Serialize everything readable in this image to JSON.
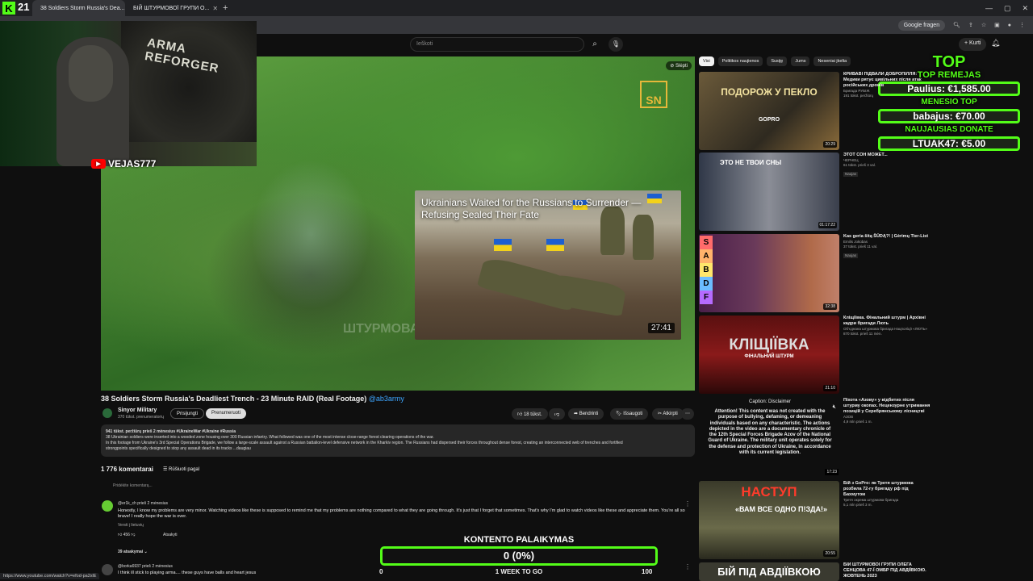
{
  "browser": {
    "tabs": [
      {
        "label": "38 Soldiers Storm Russia's Dea..."
      },
      {
        "label": "БІЙ ШТУРМОВОЇ ГРУПИ О..."
      }
    ],
    "google_pill": "Google fragen",
    "status_url": "https://www.youtube.com/watch?v=efod-pa2xlE"
  },
  "stream": {
    "kick_count": "21",
    "youtube_name": "VEJAS777",
    "poster_text": "ARMA REFORGER"
  },
  "search": {
    "placeholder": "Ieškoti"
  },
  "header": {
    "create_label": "Kurti"
  },
  "video": {
    "hide_label": "Slėpti",
    "logo": "SN",
    "watermark": "ШТУРМОВА БРИГАДА",
    "endcard": {
      "title": "Ukrainians Waited for the Russians to Surrender — Refusing Sealed Their Fate",
      "duration": "27:41"
    }
  },
  "donations": {
    "top": "TOP",
    "top_remejas": "TOP REMEJAS",
    "top_remejas_entry": "Paulius: €1,585.00",
    "menesio_top": "MENESIO TOP",
    "menesio_top_entry": "babajus: €70.00",
    "naujausias": "NAUJAUSIAS DONATE",
    "naujausias_entry": "LTUAK47: €5.00"
  },
  "watch": {
    "title": "38 Soldiers Storm Russia's Deadliest Trench - 23 Minute RAID (Real Footage)",
    "title_tag": "@ab3army",
    "channel": "Sinyor Military",
    "subs": "370 tūkst. prenumeratorių",
    "join": "Prisijungti",
    "subscribe": "Prenumeruoti",
    "likes": "18 tūkst.",
    "share": "Bendrinti",
    "save": "Išsaugoti",
    "clip": "Atkirpti",
    "desc_meta": "941 tūkst. peržiūrų  prieš 2 mėnesius  #UkraineWar #Ukraine #Russia",
    "desc_line1": "38 Ukrainian soldiers were inserted into a wooded zone housing over 300 Russian infantry. What followed was one of the most intense close-range forest clearing operations of the war.",
    "desc_line2": "In this footage from Ukraine's 3rd Special Operations Brigade, we follow a large-scale assault against a Russian battalion-level defensive network in the Kharkiv region. The Russians had dispersed their forces throughout dense forest, creating an interconnected web of trenches and fortified",
    "desc_line3": "strongpoints specifically designed to stop any assault dead in its tracks   ...daugiau"
  },
  "comments": {
    "count": "1 776 komentarai",
    "sort": "Rūšiuoti pagal",
    "add_placeholder": "Pridėkite komentarą...",
    "items": [
      {
        "user": "@er1k_ch  prieš 2 mėnesius",
        "text": "Honestly, I know my problems are very minor. Watching videos like these is supposed to remind me that my problems are nothing compared to what they are going through. It's just that I forget that sometimes. That's why I'm glad to watch videos like these and appreciate them. You're all so brave! I really hope the war is over.",
        "translate": "Versti į lietuvių",
        "likes": "456",
        "reply": "Atsakyti",
        "replies": "39 atsakymai"
      },
      {
        "user": "@borka6937  prieš 2 mėnesius",
        "text": "I think ill stick to playing arma.... these guys have balls and heart jesus"
      }
    ]
  },
  "sidebar": {
    "chips": [
      "Visi",
      "Politikos naujienos",
      "Susiję",
      "Jums",
      "Neseniai įkelta"
    ],
    "recs": [
      {
        "title": "КРИВАВІ ПІДВАЛИ ДОБРОПІЛЛЯ: Медики рятує цивільних після атак російських дронів",
        "channel": "Бригада РУБІЖ",
        "meta": "191 tūkst. peržiūrų",
        "thumb_text": "ПОДОРОЖ У ПЕКЛО",
        "thumb_sub": "GOPRO",
        "duration": "20:29"
      },
      {
        "title": "ЭТОТ СОН МОЖЕТ...",
        "channel": "ЧЕРНЕЦ",
        "meta": "61 tūkst.  prieš 3 val.",
        "badge": "Naujas",
        "thumb_text": "ЭТО НЕ ТВОИ СНЫ",
        "duration": "01:17:22"
      },
      {
        "title": "Kas geria šitą ŠŪDĄ?! | Gėrimų Tier-List",
        "channel": "Emilis Jokūbas",
        "meta": "37 tūkst.  prieš 11 val.",
        "badge": "Naujas",
        "tiers": [
          "S",
          "A",
          "B",
          "D",
          "F"
        ],
        "duration": "32:38"
      },
      {
        "title": "Кліщіївка. Фінальний штурм | Архівні кадри бригади Лють",
        "channel": "Об'єднана штурмова бригада Нацполіції «ЛЮТЬ»",
        "meta": "870 tūkst.  prieš 11 mėn.",
        "thumb_text": "КЛІЩІЇВКА",
        "thumb_sub": "ФІНАЛЬНИЙ ШТУРМ",
        "duration": "21:10"
      },
      {
        "title": "Піхота «Азову» у відбитих після штурму окопах. Нецензурне утримання позицій у Серебрянському лісництві",
        "channel": "АЗОВ",
        "meta": "4,9 mln  prieš 1 m.",
        "duration": "17:23"
      },
      {
        "title": "Бій з GoPro: як Третя штурмова розбила 72-гу бригаду рф під Бахмутом",
        "channel": "Третя окрема штурмова бригада",
        "meta": "5,1 mln  prieš 3 m.",
        "thumb_text": "НАСТУП",
        "thumb_sub": "«ВАМ ВСЕ ОДНО П!ЗДА!»",
        "duration": "20:55"
      },
      {
        "title": "БІЙ ШТУРМОВОЇ ГРУПИ ОЛЕГА СЕНЦОВА 47-Ї ОМБР ПІД АВДІЇВКОЮ. ЖОВТЕНЬ 2023",
        "thumb_text": "БІЙ ПІД АВДІЇВКОЮ"
      }
    ],
    "disclaimer": {
      "caption": "Caption: Disclaimer",
      "text": "Attention! This content was not created with the purpose of bullying, defaming, or demeaning individuals based on any characteristic. The actions depicted in the video are a documentary chronicle of the 12th Special Forces Brigade Azov of the National Guard of Ukraine. The military unit operates solely for the defense and protection of Ukraine, in accordance with its current legislation."
    }
  },
  "goal": {
    "title": "KONTENTO PALAIKYMAS",
    "value_label": "0 (0%)",
    "progress": 0,
    "min": "0",
    "period": "1 WEEK TO GO",
    "max": "100"
  }
}
